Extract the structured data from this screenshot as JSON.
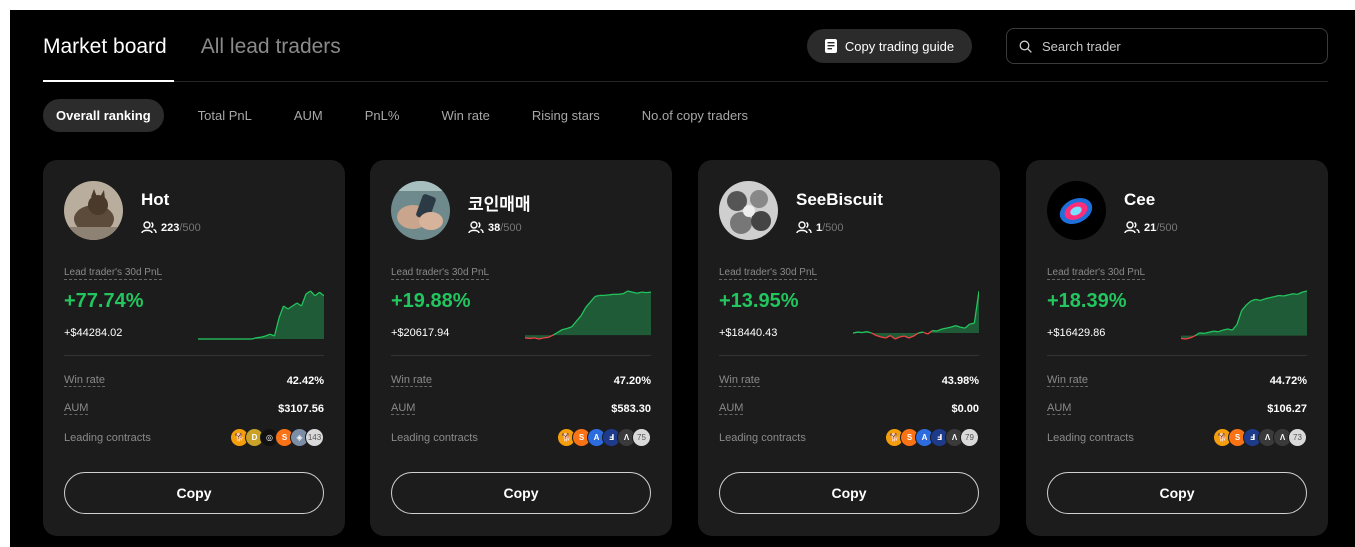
{
  "header": {
    "tabs": [
      {
        "label": "Market board",
        "active": true
      },
      {
        "label": "All lead traders",
        "active": false
      }
    ],
    "guide_label": "Copy trading guide",
    "search_placeholder": "Search trader"
  },
  "filters": [
    {
      "label": "Overall ranking",
      "active": true
    },
    {
      "label": "Total PnL",
      "active": false
    },
    {
      "label": "AUM",
      "active": false
    },
    {
      "label": "PnL%",
      "active": false
    },
    {
      "label": "Win rate",
      "active": false
    },
    {
      "label": "Rising stars",
      "active": false
    },
    {
      "label": "No.of copy traders",
      "active": false
    }
  ],
  "labels": {
    "pnl_label": "Lead trader's 30d PnL",
    "win_rate": "Win rate",
    "aum": "AUM",
    "leading_contracts": "Leading contracts",
    "copy": "Copy"
  },
  "colors": {
    "positive": "#22c55e",
    "negative": "#ef4444",
    "card_bg": "#1c1c1c"
  },
  "traders": [
    {
      "name": "Hot",
      "followers": "223",
      "followers_max": "/500",
      "pnl_pct": "+77.74%",
      "pnl_usd": "+$44284.02",
      "win_rate": "42.42%",
      "aum": "$3107.56",
      "contracts": [
        "shib-icon",
        "doge-icon",
        "ring-icon",
        "sol-icon",
        "wallet-icon"
      ],
      "contracts_more": "143",
      "avatar": "cat-photo",
      "spark": [
        0,
        0,
        0,
        0,
        0,
        0,
        0,
        0,
        0,
        0,
        0,
        0,
        0,
        0.02,
        0.03,
        0.05,
        0.08,
        0.05,
        0.35,
        0.55,
        0.5,
        0.55,
        0.6,
        0.55,
        0.75,
        0.8,
        0.72,
        0.78,
        0.72
      ]
    },
    {
      "name": "코인매매",
      "followers": "38",
      "followers_max": "/500",
      "pnl_pct": "+19.88%",
      "pnl_usd": "+$20617.94",
      "win_rate": "47.20%",
      "aum": "$583.30",
      "contracts": [
        "shib-icon",
        "sol-icon",
        "arb-icon",
        "ace-icon",
        "avax-icon"
      ],
      "contracts_more": "75",
      "avatar": "phone-photo",
      "spark": [
        -0.05,
        -0.06,
        -0.05,
        -0.07,
        -0.05,
        -0.04,
        0,
        0.05,
        0.1,
        0.12,
        0.15,
        0.25,
        0.35,
        0.5,
        0.6,
        0.7,
        0.72,
        0.72,
        0.73,
        0.74,
        0.74,
        0.75,
        0.8,
        0.78,
        0.76,
        0.78,
        0.77,
        0.78
      ]
    },
    {
      "name": "SeeBiscuit",
      "followers": "1",
      "followers_max": "/500",
      "pnl_pct": "+13.95%",
      "pnl_usd": "+$18440.43",
      "win_rate": "43.98%",
      "aum": "$0.00",
      "contracts": [
        "shib-icon",
        "sol-icon",
        "arb-icon",
        "ace-icon",
        "avax-icon"
      ],
      "contracts_more": "79",
      "avatar": "collage-photo",
      "spark": [
        0,
        0.02,
        0.01,
        0.03,
        0.0,
        -0.05,
        -0.08,
        -0.1,
        -0.05,
        -0.12,
        -0.08,
        -0.06,
        -0.1,
        -0.06,
        0,
        0.02,
        -0.02,
        0.05,
        0.04,
        0.08,
        0.1,
        0.12,
        0.15,
        0.12,
        0.1,
        0.18,
        0.2,
        0.85
      ]
    },
    {
      "name": "Cee",
      "followers": "21",
      "followers_max": "/500",
      "pnl_pct": "+18.39%",
      "pnl_usd": "+$16429.86",
      "win_rate": "44.72%",
      "aum": "$106.27",
      "contracts": [
        "shib-icon",
        "sol-icon",
        "ace-icon",
        "avax-icon",
        "avax-icon"
      ],
      "contracts_more": "73",
      "avatar": "neon-coin",
      "spark": [
        -0.05,
        -0.06,
        -0.04,
        0,
        0.05,
        0.04,
        0.06,
        0.08,
        0.07,
        0.1,
        0.12,
        0.1,
        0.2,
        0.45,
        0.55,
        0.62,
        0.65,
        0.63,
        0.66,
        0.68,
        0.7,
        0.72,
        0.71,
        0.73,
        0.75,
        0.74,
        0.78,
        0.8
      ]
    }
  ]
}
